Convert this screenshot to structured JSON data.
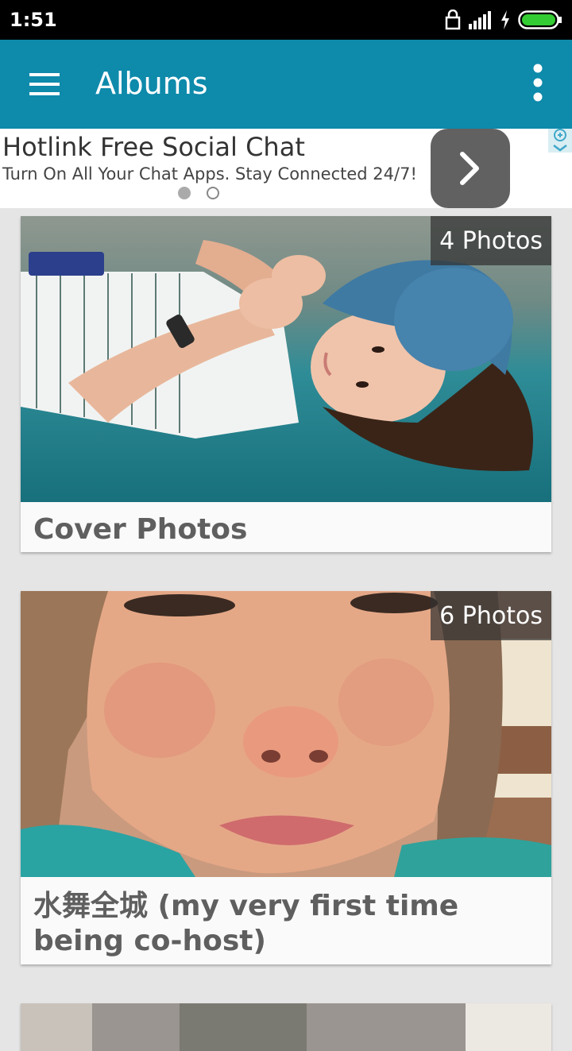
{
  "status_bar": {
    "time": "1:51"
  },
  "toolbar": {
    "title": "Albums"
  },
  "ad": {
    "title": "Hotlink Free Social Chat",
    "subtitle": "Turn On All Your Chat Apps. Stay Connected 24/7!"
  },
  "albums": [
    {
      "title": "Cover Photos",
      "count": "4 Photos"
    },
    {
      "title": "水舞全城 (my very first time being co-host)",
      "count": "6 Photos"
    }
  ],
  "colors": {
    "toolbar": "#0e8aab",
    "status_bar": "#000000",
    "battery": "#33cc33"
  },
  "icons": [
    "lock-icon",
    "signal-icon",
    "charging-icon",
    "battery-icon",
    "menu-icon",
    "more-vert-icon",
    "chevron-right-icon",
    "adchoices-icon"
  ]
}
